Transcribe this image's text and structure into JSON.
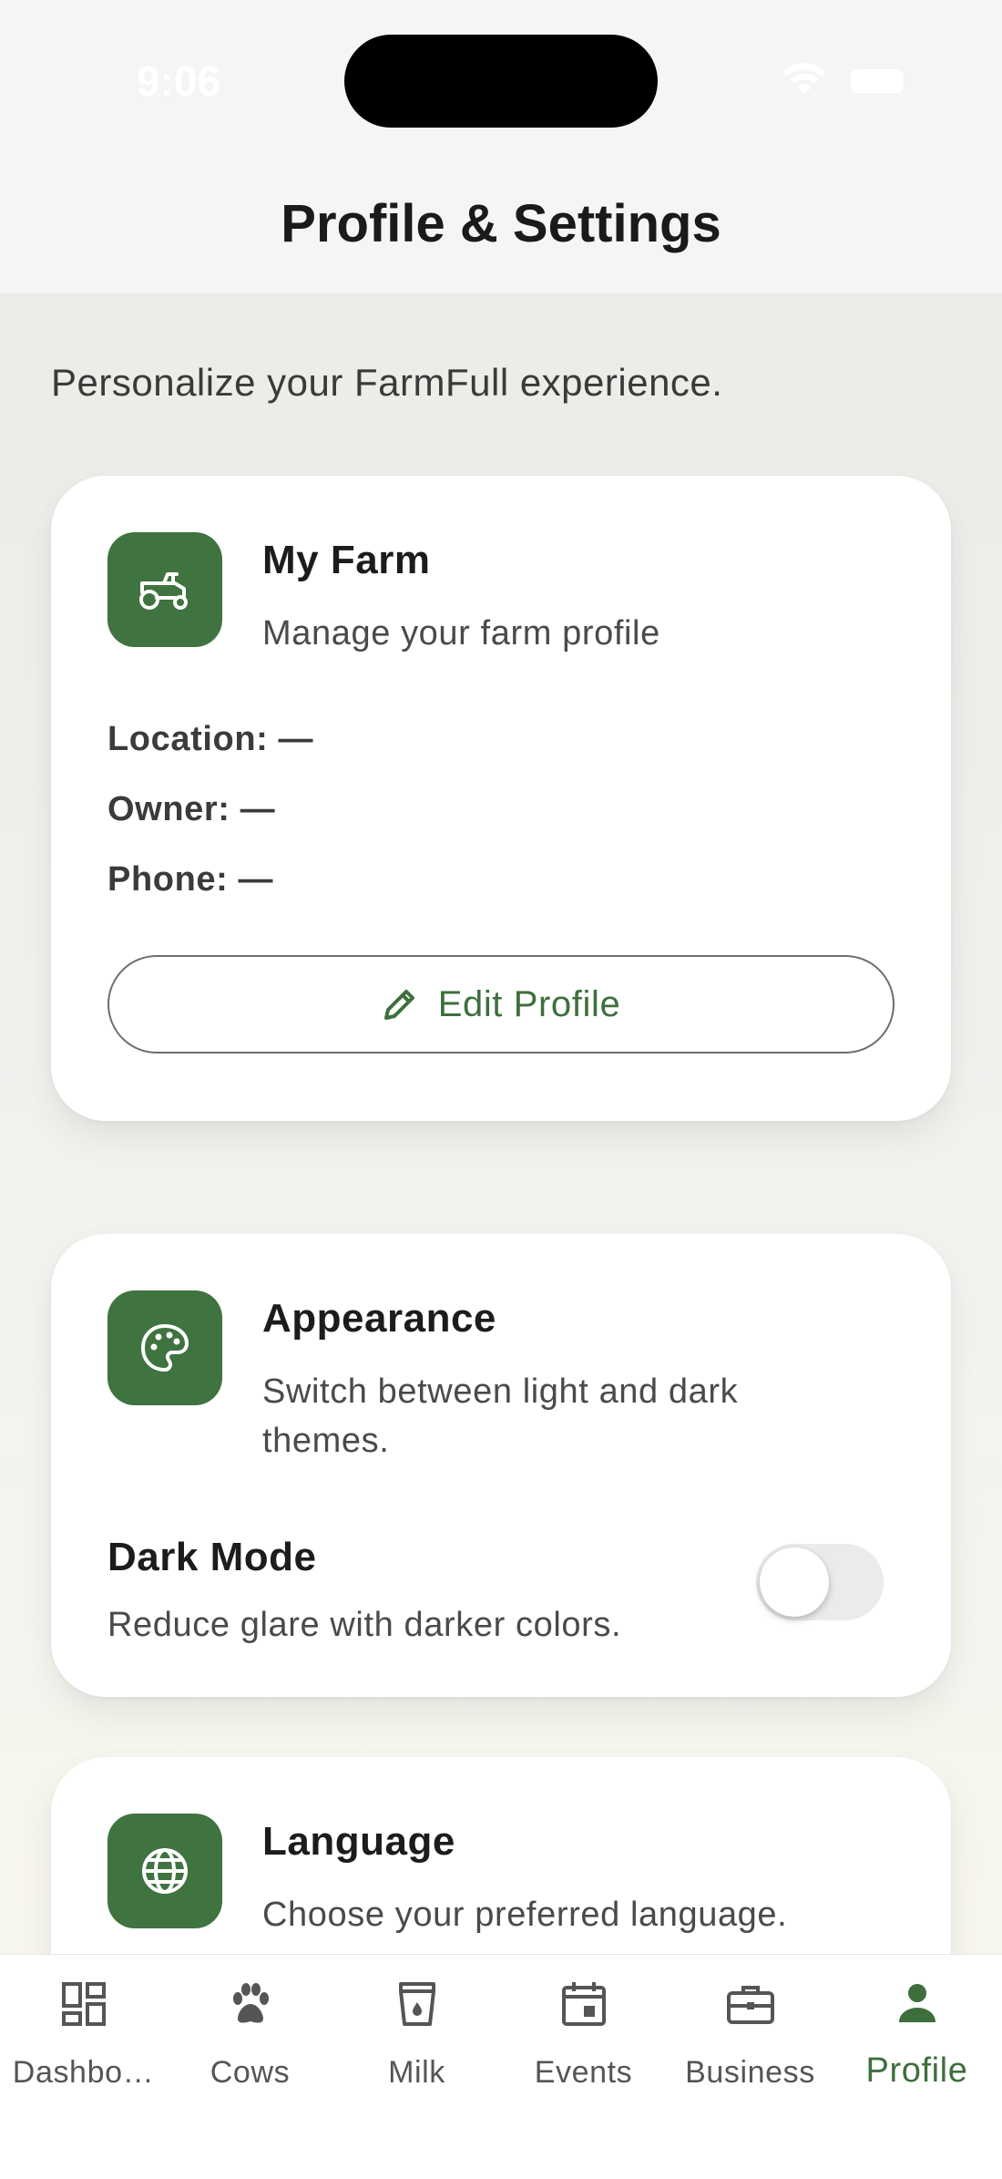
{
  "status_bar": {
    "time": "9:06"
  },
  "header": {
    "title": "Profile & Settings"
  },
  "intro": "Personalize your FarmFull experience.",
  "farm_card": {
    "icon": "tractor-icon",
    "title": "My Farm",
    "subtitle": "Manage your farm profile",
    "location": "Location: —",
    "owner": "Owner: —",
    "phone": "Phone: —",
    "edit_label": "Edit Profile"
  },
  "appearance_card": {
    "icon": "palette-icon",
    "title": "Appearance",
    "subtitle": "Switch between light and dark themes.",
    "dark_mode_title": "Dark Mode",
    "dark_mode_sub": "Reduce glare with darker colors.",
    "dark_mode_enabled": false
  },
  "language_card": {
    "icon": "globe-icon",
    "title": "Language",
    "subtitle": "Choose your preferred language."
  },
  "nav": {
    "items": [
      {
        "label": "Dashbo…",
        "icon": "dashboard-icon"
      },
      {
        "label": "Cows",
        "icon": "paw-icon"
      },
      {
        "label": "Milk",
        "icon": "milk-icon"
      },
      {
        "label": "Events",
        "icon": "calendar-icon"
      },
      {
        "label": "Business",
        "icon": "briefcase-icon"
      },
      {
        "label": "Profile",
        "icon": "person-icon"
      }
    ],
    "active": "Profile"
  },
  "colors": {
    "accent": "#3f7340",
    "accent_text": "#3d6f3d"
  }
}
